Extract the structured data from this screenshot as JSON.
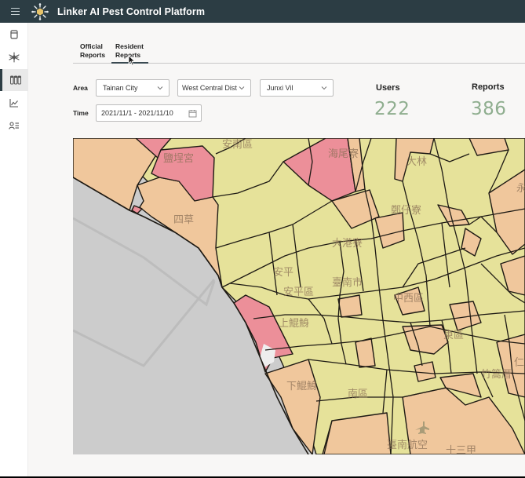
{
  "header": {
    "title": "Linker AI Pest Control Platform",
    "menu_icon": "hamburger-menu-icon",
    "logo_icon": "sun-logo-icon"
  },
  "sidebar": {
    "items": [
      {
        "id": "trap",
        "icon": "container-icon",
        "active": false
      },
      {
        "id": "mosquito",
        "icon": "mosquito-icon",
        "active": false
      },
      {
        "id": "specimens",
        "icon": "specimen-tubes-icon",
        "active": true
      },
      {
        "id": "analytics",
        "icon": "line-chart-icon",
        "active": false
      },
      {
        "id": "users",
        "icon": "user-list-icon",
        "active": false
      }
    ]
  },
  "tabs": [
    {
      "line1": "Official",
      "line2": "Reports",
      "active": false
    },
    {
      "line1": "Resident",
      "line2": "Reports",
      "active": true
    }
  ],
  "filters": {
    "area_label": "Area",
    "time_label": "Time",
    "city": "Tainan City",
    "district": "West Central Dist",
    "village": "Junxi Vil",
    "date_range": "2021/11/1 - 2021/11/10"
  },
  "stats": {
    "users_label": "Users",
    "users_value": "222",
    "reports_label": "Reports",
    "reports_value": "386"
  },
  "map": {
    "colors": {
      "low": "#e6e29a",
      "medium": "#f0c79c",
      "high": "#ec8f99",
      "water": "#cccccc",
      "border": "#1e1a14"
    },
    "labels": [
      "安南區",
      "鹽埕宮",
      "海尾寮",
      "四草",
      "鄭仔寮",
      "大港寮",
      "安平",
      "安平區",
      "臺南市",
      "中西區",
      "東區",
      "上鯤鯓",
      "下鯤鯓",
      "南區",
      "仁",
      "竹篙厝",
      "臺南航空",
      "十三甲",
      "大林",
      "永"
    ]
  },
  "colors": {
    "topbar": "#2c3d44",
    "stat_value": "#8fae8f",
    "accent": "#3a4a52"
  }
}
